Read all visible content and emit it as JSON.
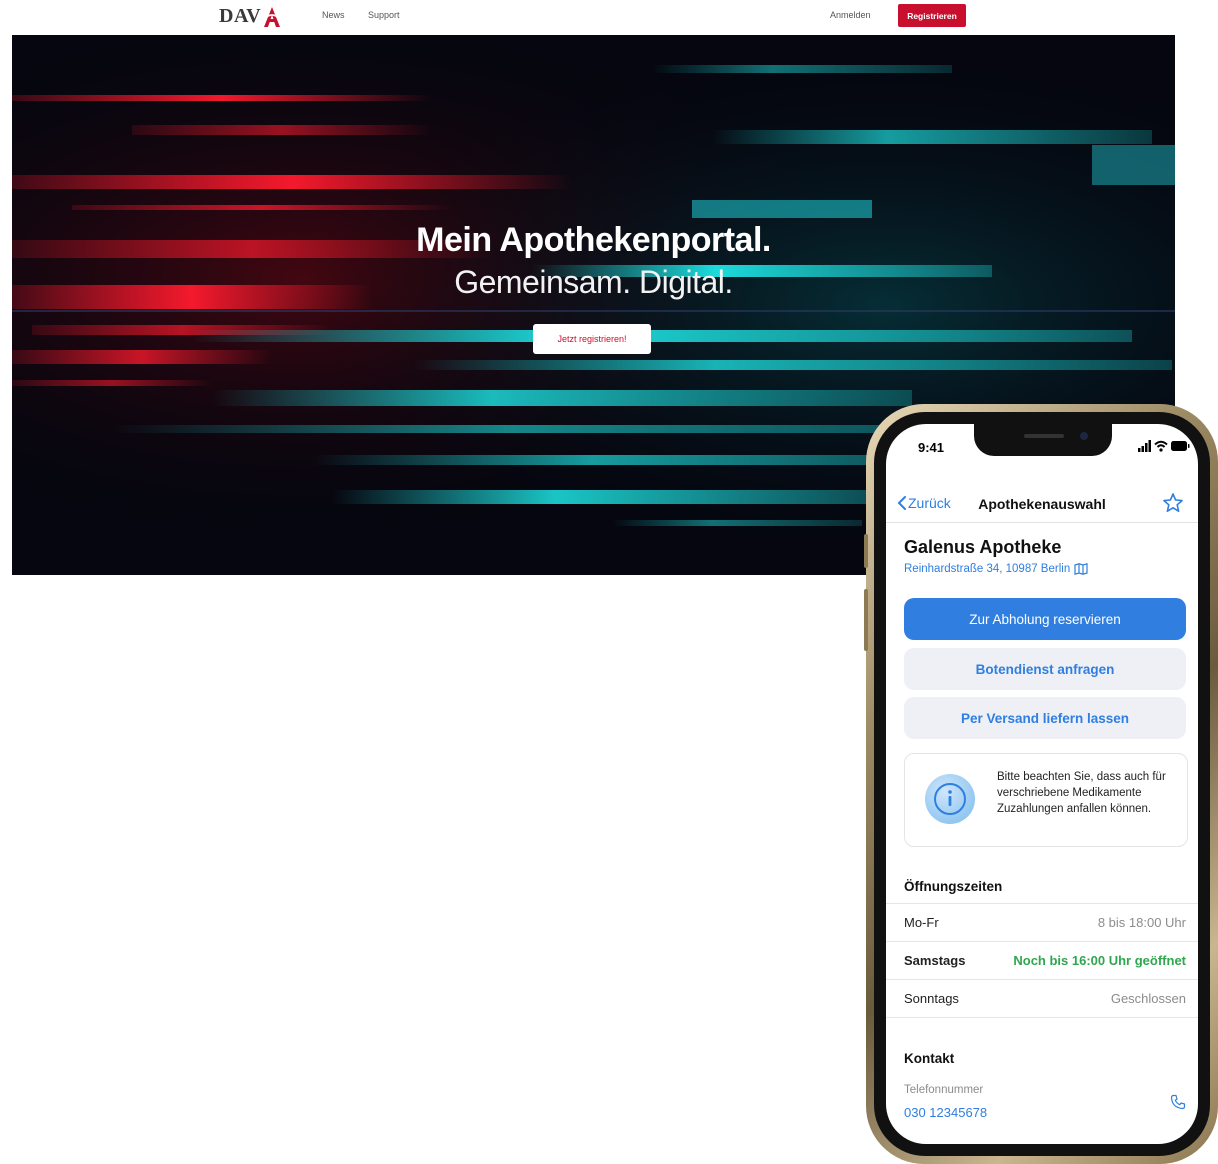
{
  "nav": {
    "logo": "DAV",
    "links": [
      "News",
      "Support"
    ],
    "login": "Anmelden",
    "register": "Registrieren",
    "brand_color": "#c8102e"
  },
  "hero": {
    "title": "Mein Apothekenportal.",
    "subtitle": "Gemeinsam. Digital.",
    "cta": "Jetzt registrieren!"
  },
  "app": {
    "status_time": "9:41",
    "back_label": "Zurück",
    "screen_title": "Apothekenauswahl",
    "pharmacy_name": "Galenus Apotheke",
    "address": "Reinhardstraße 34, 10987 Berlin",
    "actions": {
      "reserve": "Zur Abholung reservieren",
      "courier": "Botendienst anfragen",
      "shipping": "Per Versand liefern lassen"
    },
    "info_text": "Bitte beachten Sie, dass auch für verschriebene Medikamente Zuzahlungen anfallen können.",
    "hours_title": "Öffnungszeiten",
    "hours": [
      {
        "day": "Mo-Fr",
        "time": "8 bis 18:00 Uhr"
      },
      {
        "day": "Samstags",
        "time": "Noch bis 16:00 Uhr geöffnet"
      },
      {
        "day": "Sonntags",
        "time": "Geschlossen"
      }
    ],
    "contact_title": "Kontakt",
    "phone_label": "Telefonnummer",
    "phone_value": "030 12345678",
    "accent_color": "#2f7ee0",
    "open_color": "#2fa64f"
  }
}
